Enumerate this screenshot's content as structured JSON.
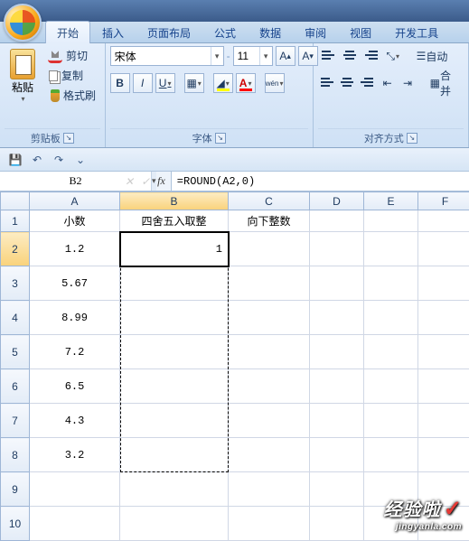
{
  "tabs": [
    "开始",
    "插入",
    "页面布局",
    "公式",
    "数据",
    "审阅",
    "视图",
    "开发工具"
  ],
  "active_tab_index": 0,
  "clipboard": {
    "paste": "粘贴",
    "cut": "剪切",
    "copy": "复制",
    "format_painter": "格式刷",
    "group": "剪贴板"
  },
  "font": {
    "name": "宋体",
    "size": "11",
    "grow": "A",
    "shrink": "A",
    "bold": "B",
    "italic": "I",
    "underline": "U",
    "group": "字体"
  },
  "align": {
    "wrap": "自动",
    "merge": "合并",
    "group": "对齐方式"
  },
  "namebox": "B2",
  "formula": "=ROUND(A2,0)",
  "columns": [
    "A",
    "B",
    "C",
    "D",
    "E",
    "F"
  ],
  "row_headers": [
    "1",
    "2",
    "3",
    "4",
    "5",
    "6",
    "7",
    "8",
    "9",
    "10"
  ],
  "sheet": {
    "A1": "小数",
    "B1": "四舍五入取整",
    "C1": "向下整数",
    "A2": "1.2",
    "B2": "1",
    "A3": "5.67",
    "A4": "8.99",
    "A5": "7.2",
    "A6": "6.5",
    "A7": "4.3",
    "A8": "3.2"
  },
  "watermark": {
    "brand": "经验啦",
    "check": "✓",
    "url": "jingyanla.com"
  }
}
